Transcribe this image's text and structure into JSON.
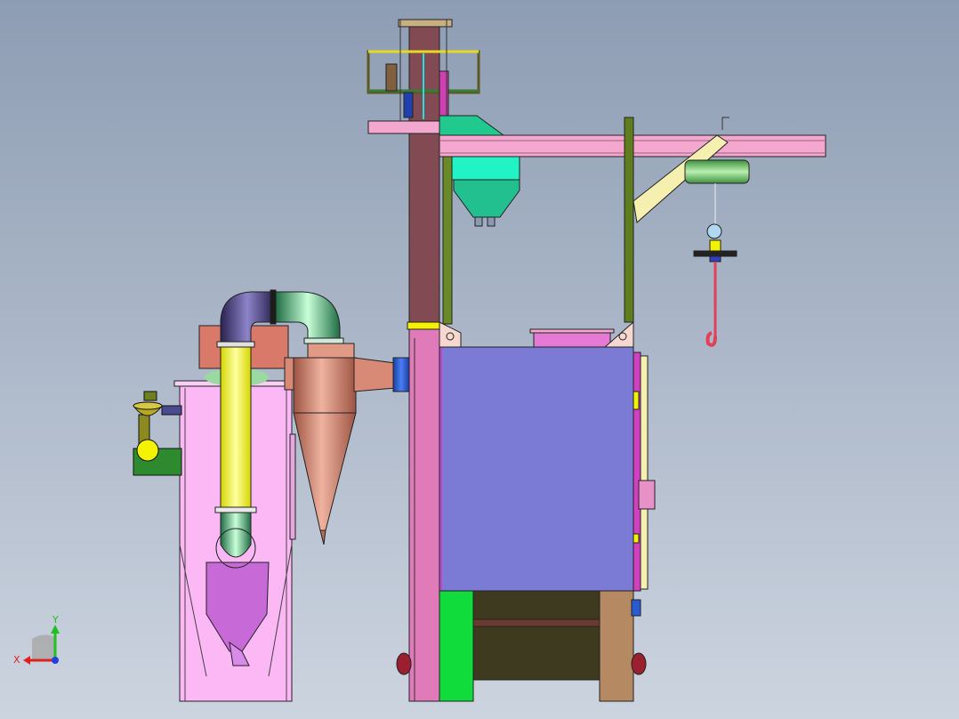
{
  "viewport": {
    "background_top": "#8e9db4",
    "background_bottom": "#ccd4df"
  },
  "triad": {
    "x_label": "X",
    "y_label": "Y",
    "x_color": "#e02020",
    "y_color": "#20c020",
    "z_color": "#2040e0"
  },
  "colors": {
    "cabinet_body": "#7b7bd6",
    "column": "#824a52",
    "pink_frame": "#e07ab9",
    "rail": "#f4a8cf",
    "cyclone": "#cc7f6a",
    "hopper_teal": "#21d3a6",
    "yellow_pipe": "#f3f300",
    "dust_collector": "#fcb7f5",
    "green_leg": "#10dc3c",
    "dark_base": "#3e3a1f",
    "brown_leg": "#b58a62",
    "olive_post": "#5f7d1e"
  }
}
